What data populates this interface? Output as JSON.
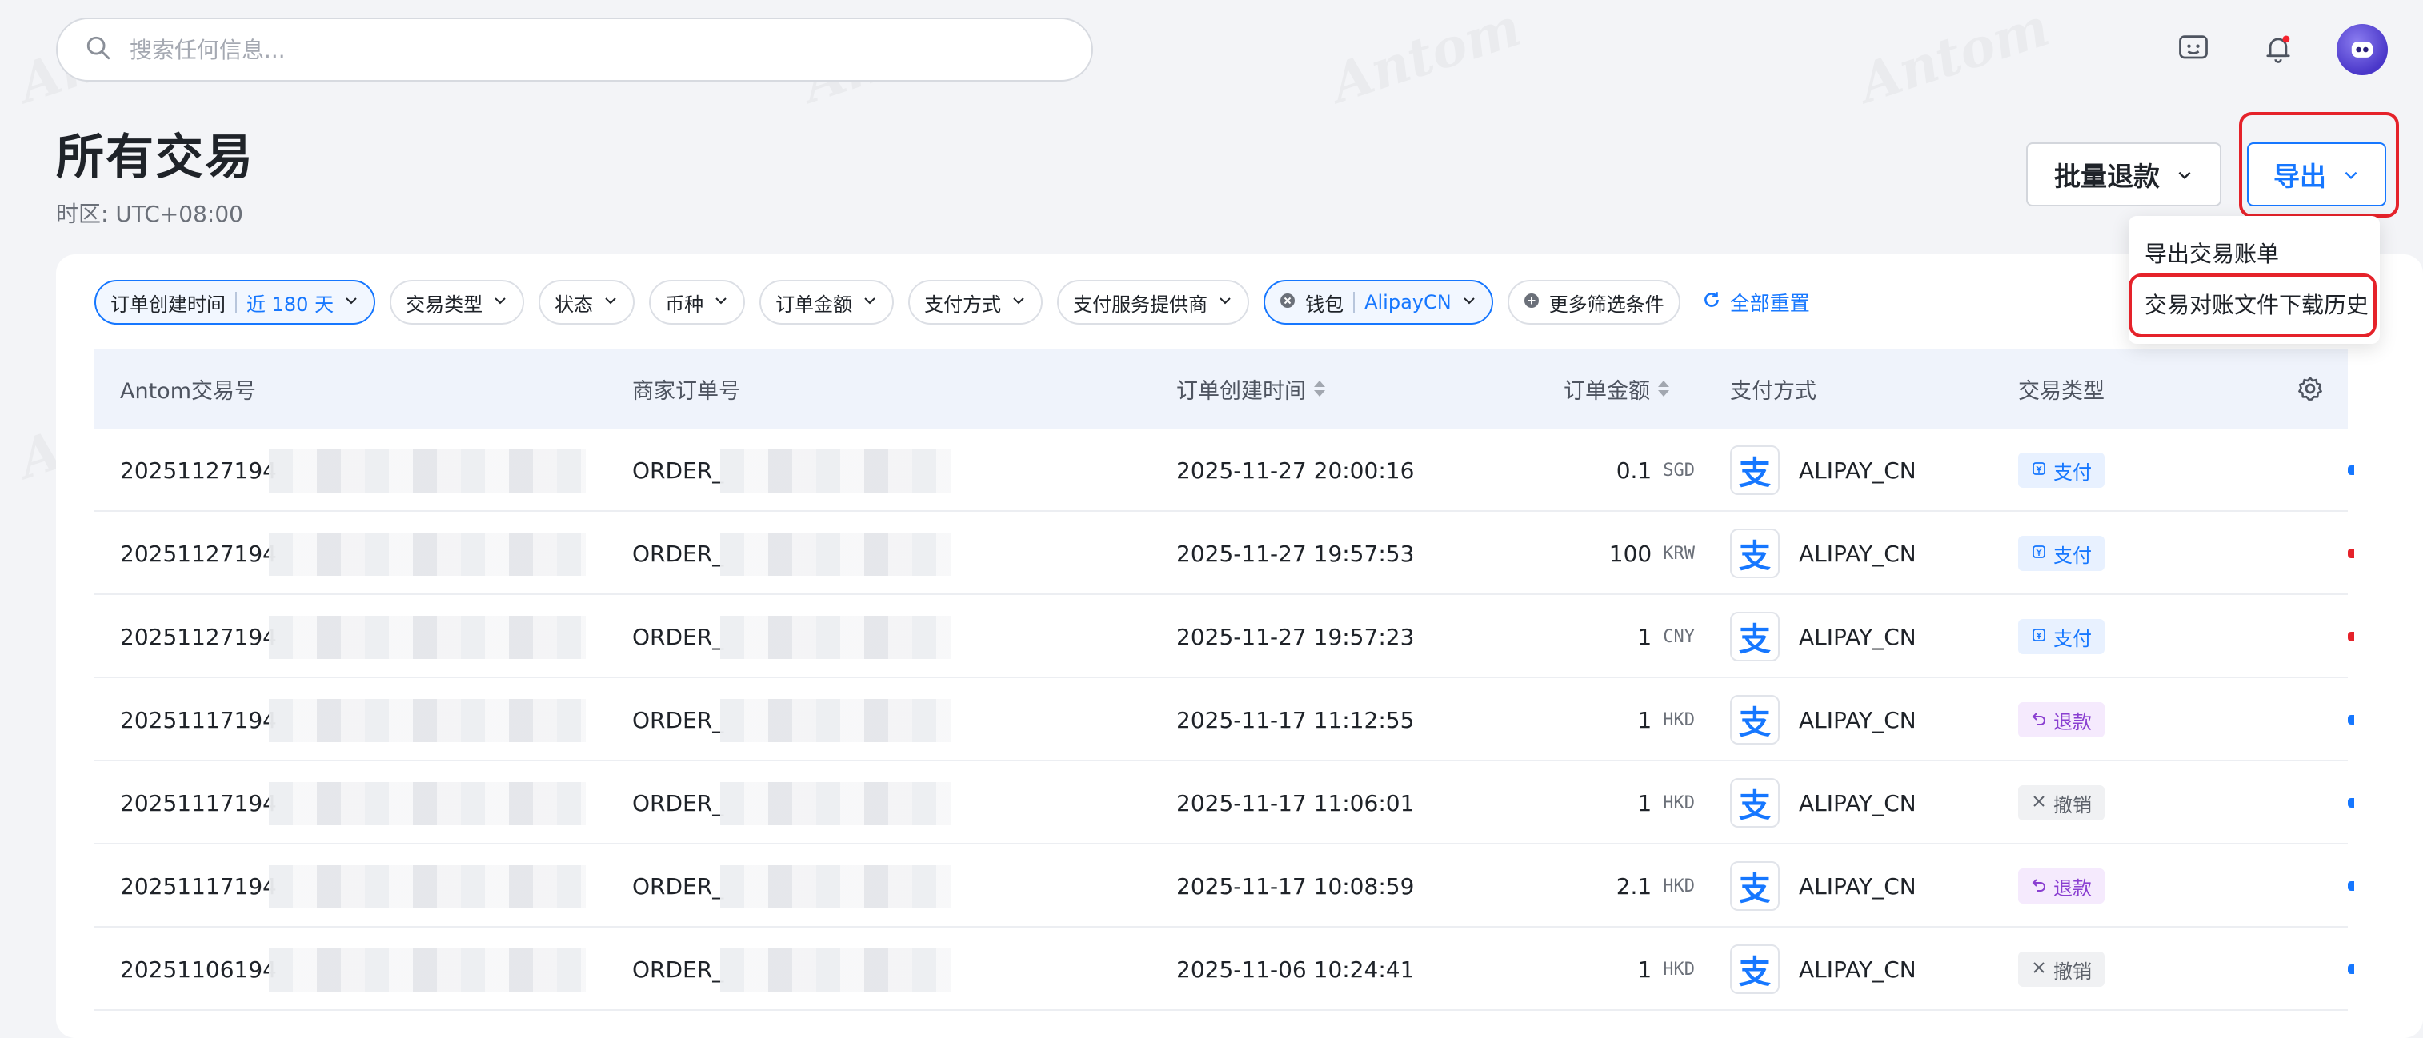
{
  "search": {
    "placeholder": "搜索任何信息..."
  },
  "header": {
    "title": "所有交易",
    "timezone": "时区: UTC+08:00",
    "refund_button": "批量退款",
    "export_button": "导出"
  },
  "export_menu": {
    "items": [
      "导出交易账单",
      "交易对账文件下载历史"
    ]
  },
  "filters": {
    "created_time": {
      "label": "订单创建时间",
      "value": "近 180 天"
    },
    "tx_type": "交易类型",
    "status": "状态",
    "currency": "币种",
    "amount": "订单金额",
    "payment_method": "支付方式",
    "provider": "支付服务提供商",
    "wallet": {
      "label": "钱包",
      "value": "AlipayCN"
    },
    "more": "更多筛选条件",
    "reset": "全部重置"
  },
  "table": {
    "columns": [
      "Antom交易号",
      "商家订单号",
      "订单创建时间",
      "订单金额",
      "支付方式",
      "交易类型"
    ],
    "rows": [
      {
        "tx_no": "20251127194",
        "order_no": "ORDER_",
        "time": "2025-11-27 20:00:16",
        "amount": "0.1",
        "currency": "SGD",
        "method": "ALIPAY_CN",
        "type": "支付",
        "type_kind": "pay",
        "edge_color": "#1677ff"
      },
      {
        "tx_no": "20251127194",
        "order_no": "ORDER_",
        "time": "2025-11-27 19:57:53",
        "amount": "100",
        "currency": "KRW",
        "method": "ALIPAY_CN",
        "type": "支付",
        "type_kind": "pay",
        "edge_color": "#e5222a"
      },
      {
        "tx_no": "20251127194",
        "order_no": "ORDER_",
        "time": "2025-11-27 19:57:23",
        "amount": "1",
        "currency": "CNY",
        "method": "ALIPAY_CN",
        "type": "支付",
        "type_kind": "pay",
        "edge_color": "#e5222a"
      },
      {
        "tx_no": "20251117194",
        "order_no": "ORDER_",
        "time": "2025-11-17 11:12:55",
        "amount": "1",
        "currency": "HKD",
        "method": "ALIPAY_CN",
        "type": "退款",
        "type_kind": "refund",
        "edge_color": "#1677ff"
      },
      {
        "tx_no": "20251117194",
        "order_no": "ORDER_",
        "time": "2025-11-17 11:06:01",
        "amount": "1",
        "currency": "HKD",
        "method": "ALIPAY_CN",
        "type": "撤销",
        "type_kind": "cancel",
        "edge_color": "#1677ff"
      },
      {
        "tx_no": "20251117194",
        "order_no": "ORDER_",
        "time": "2025-11-17 10:08:59",
        "amount": "2.1",
        "currency": "HKD",
        "method": "ALIPAY_CN",
        "type": "退款",
        "type_kind": "refund",
        "edge_color": "#1677ff"
      },
      {
        "tx_no": "20251106194",
        "order_no": "ORDER_",
        "time": "2025-11-06 10:24:41",
        "amount": "1",
        "currency": "HKD",
        "method": "ALIPAY_CN",
        "type": "撤销",
        "type_kind": "cancel",
        "edge_color": "#1677ff"
      }
    ]
  },
  "colors": {
    "accent": "#1677ff",
    "highlight": "#e5222a"
  }
}
